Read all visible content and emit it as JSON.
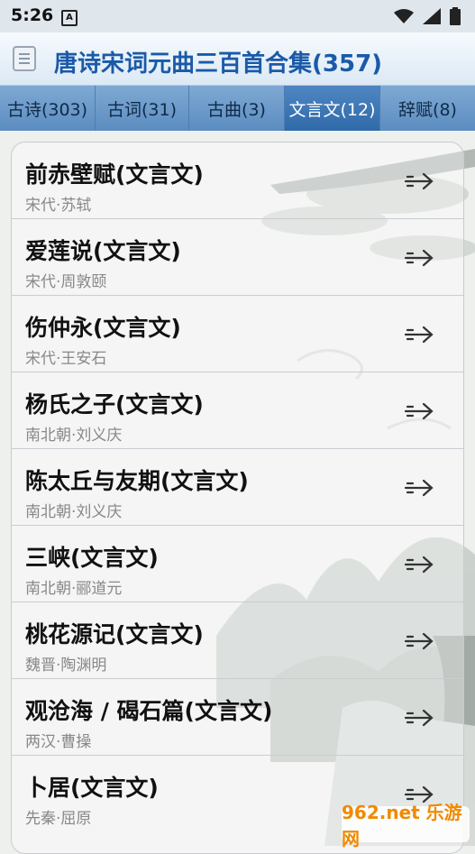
{
  "status": {
    "time": "5:26",
    "a_icon": "A"
  },
  "header": {
    "title": "唐诗宋词元曲三百首合集(357)",
    "menu_icon": "menu-icon"
  },
  "tabs": [
    {
      "label": "古诗(303)",
      "active": false
    },
    {
      "label": "古词(31)",
      "active": false
    },
    {
      "label": "古曲(3)",
      "active": false
    },
    {
      "label": "文言文(12)",
      "active": true
    },
    {
      "label": "辞赋(8)",
      "active": false
    }
  ],
  "items": [
    {
      "title": "前赤壁赋(文言文)",
      "subtitle": "宋代·苏轼"
    },
    {
      "title": "爱莲说(文言文)",
      "subtitle": "宋代·周敦颐"
    },
    {
      "title": "伤仲永(文言文)",
      "subtitle": "宋代·王安石"
    },
    {
      "title": "杨氏之子(文言文)",
      "subtitle": "南北朝·刘义庆"
    },
    {
      "title": "陈太丘与友期(文言文)",
      "subtitle": "南北朝·刘义庆"
    },
    {
      "title": "三峡(文言文)",
      "subtitle": "南北朝·郦道元"
    },
    {
      "title": "桃花源记(文言文)",
      "subtitle": "魏晋·陶渊明"
    },
    {
      "title": "观沧海 / 碣石篇(文言文)",
      "subtitle": "两汉·曹操"
    },
    {
      "title": "卜居(文言文)",
      "subtitle": "先秦·屈原"
    }
  ],
  "watermark": "962.net 乐游网",
  "colors": {
    "title": "#1a5aa8",
    "tab_active": "#2f6aa9",
    "tab_bar": "#6a9bcc"
  }
}
